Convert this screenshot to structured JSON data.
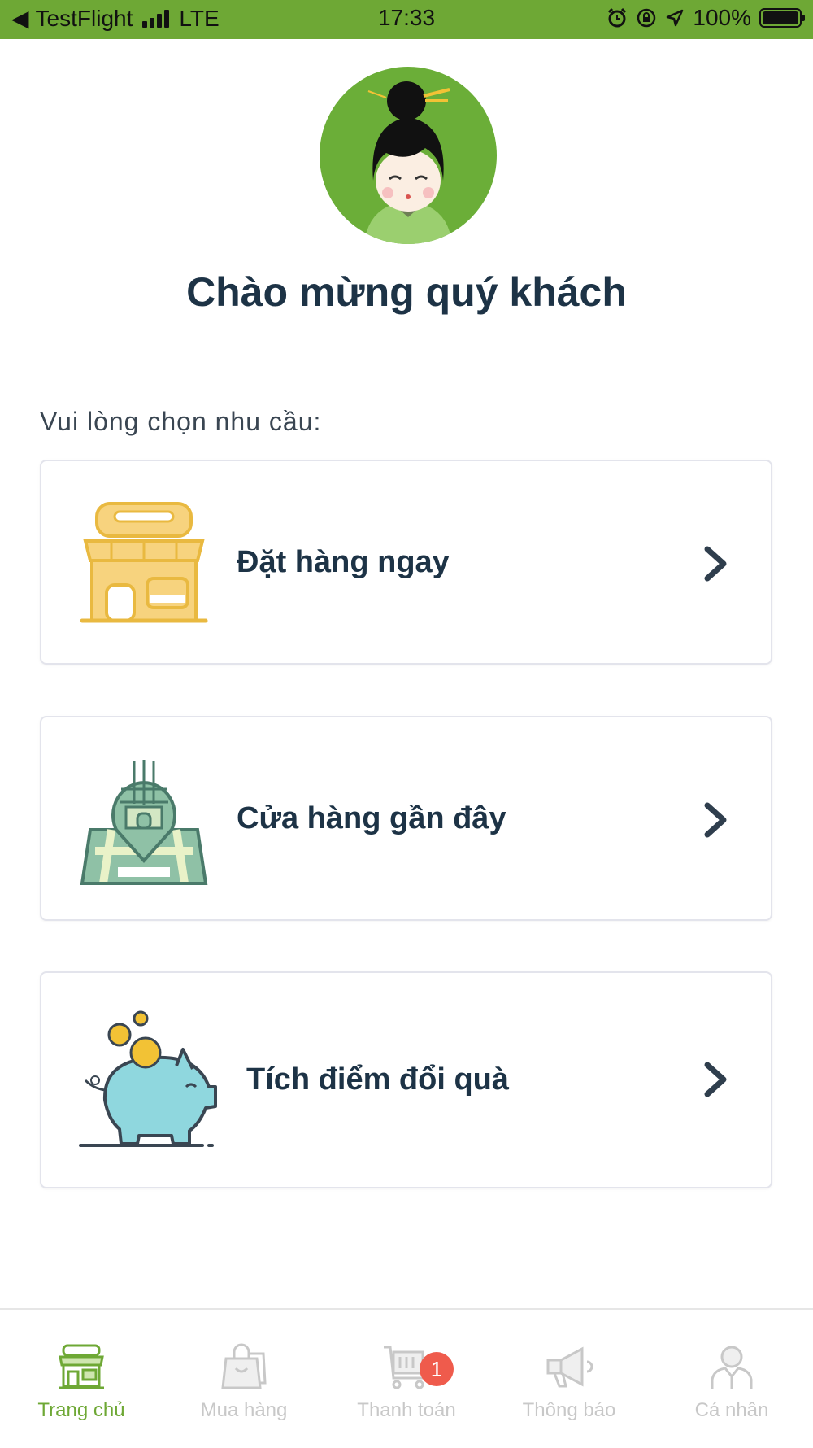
{
  "status_bar": {
    "back_app": "TestFlight",
    "network": "LTE",
    "time": "17:33",
    "battery": "100%"
  },
  "welcome": {
    "title": "Chào mừng quý khách",
    "prompt": "Vui lòng chọn nhu cầu:"
  },
  "options": [
    {
      "label": "Đặt hàng ngay",
      "icon": "store-icon"
    },
    {
      "label": "Cửa hàng gần đây",
      "icon": "map-pin-store-icon"
    },
    {
      "label": "Tích điểm đổi quà",
      "icon": "piggy-bank-icon"
    }
  ],
  "tabs": [
    {
      "label": "Trang chủ",
      "icon": "home-store-icon",
      "active": true
    },
    {
      "label": "Mua hàng",
      "icon": "shopping-bag-icon",
      "active": false
    },
    {
      "label": "Thanh toán",
      "icon": "cart-icon",
      "active": false,
      "badge": "1"
    },
    {
      "label": "Thông báo",
      "icon": "megaphone-icon",
      "active": false
    },
    {
      "label": "Cá nhân",
      "icon": "person-icon",
      "active": false
    }
  ],
  "colors": {
    "accent": "#6ea835",
    "text": "#1d3346",
    "badge": "#ef5b4c",
    "inactive_tab": "#c8c8c8"
  }
}
